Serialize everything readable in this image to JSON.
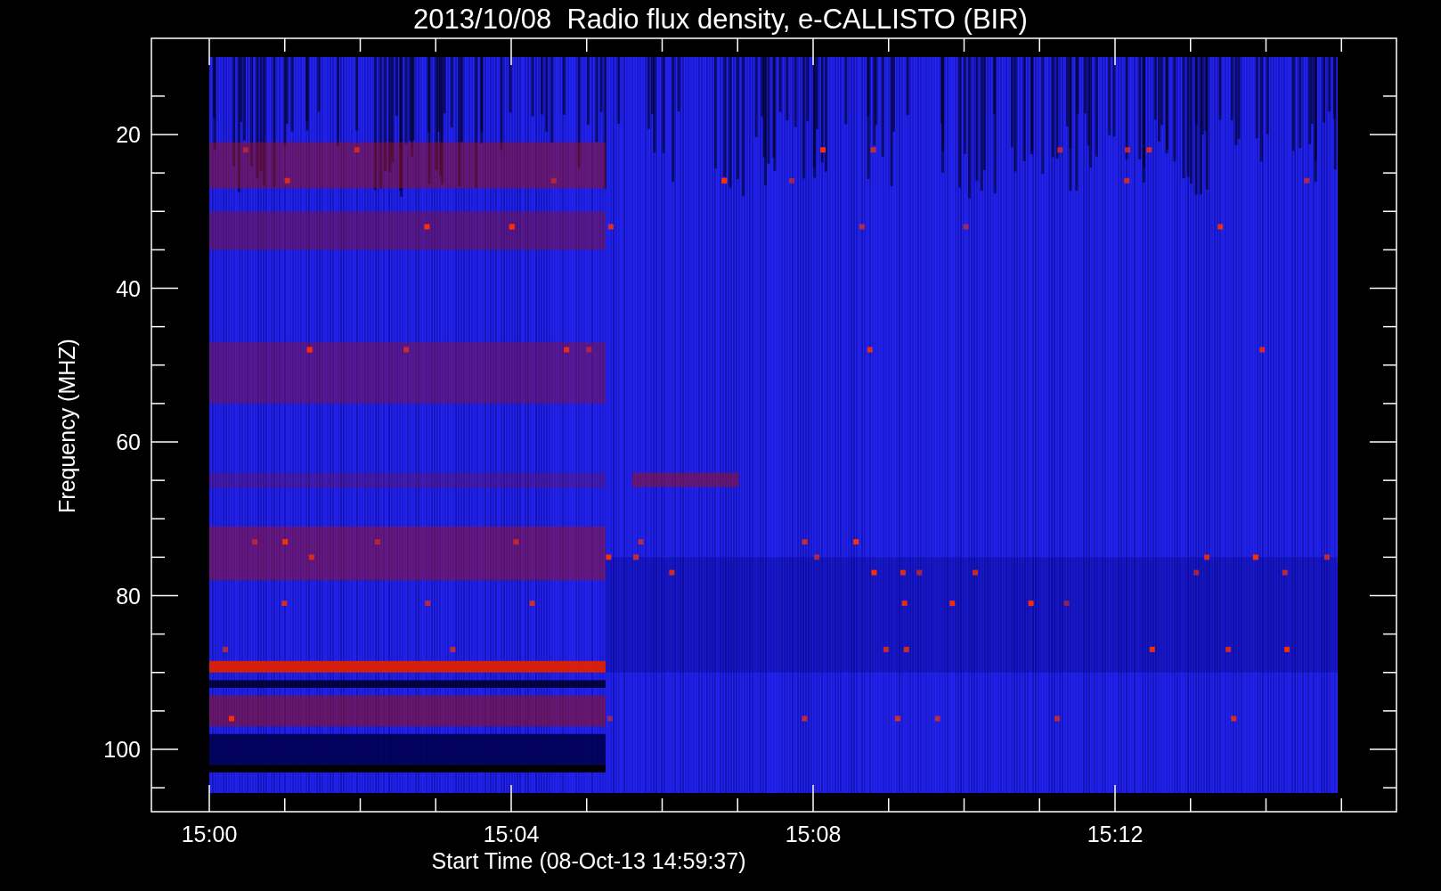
{
  "title": "2013/10/08  Radio flux density, e-CALLISTO (BIR)",
  "y_axis": {
    "label": "Frequency (MHZ)",
    "ticks": [
      "20",
      "40",
      "60",
      "80",
      "100"
    ]
  },
  "x_axis": {
    "label": "Start Time (08-Oct-13 14:59:37)",
    "ticks": [
      "15:00",
      "15:04",
      "15:08",
      "15:12"
    ]
  }
}
